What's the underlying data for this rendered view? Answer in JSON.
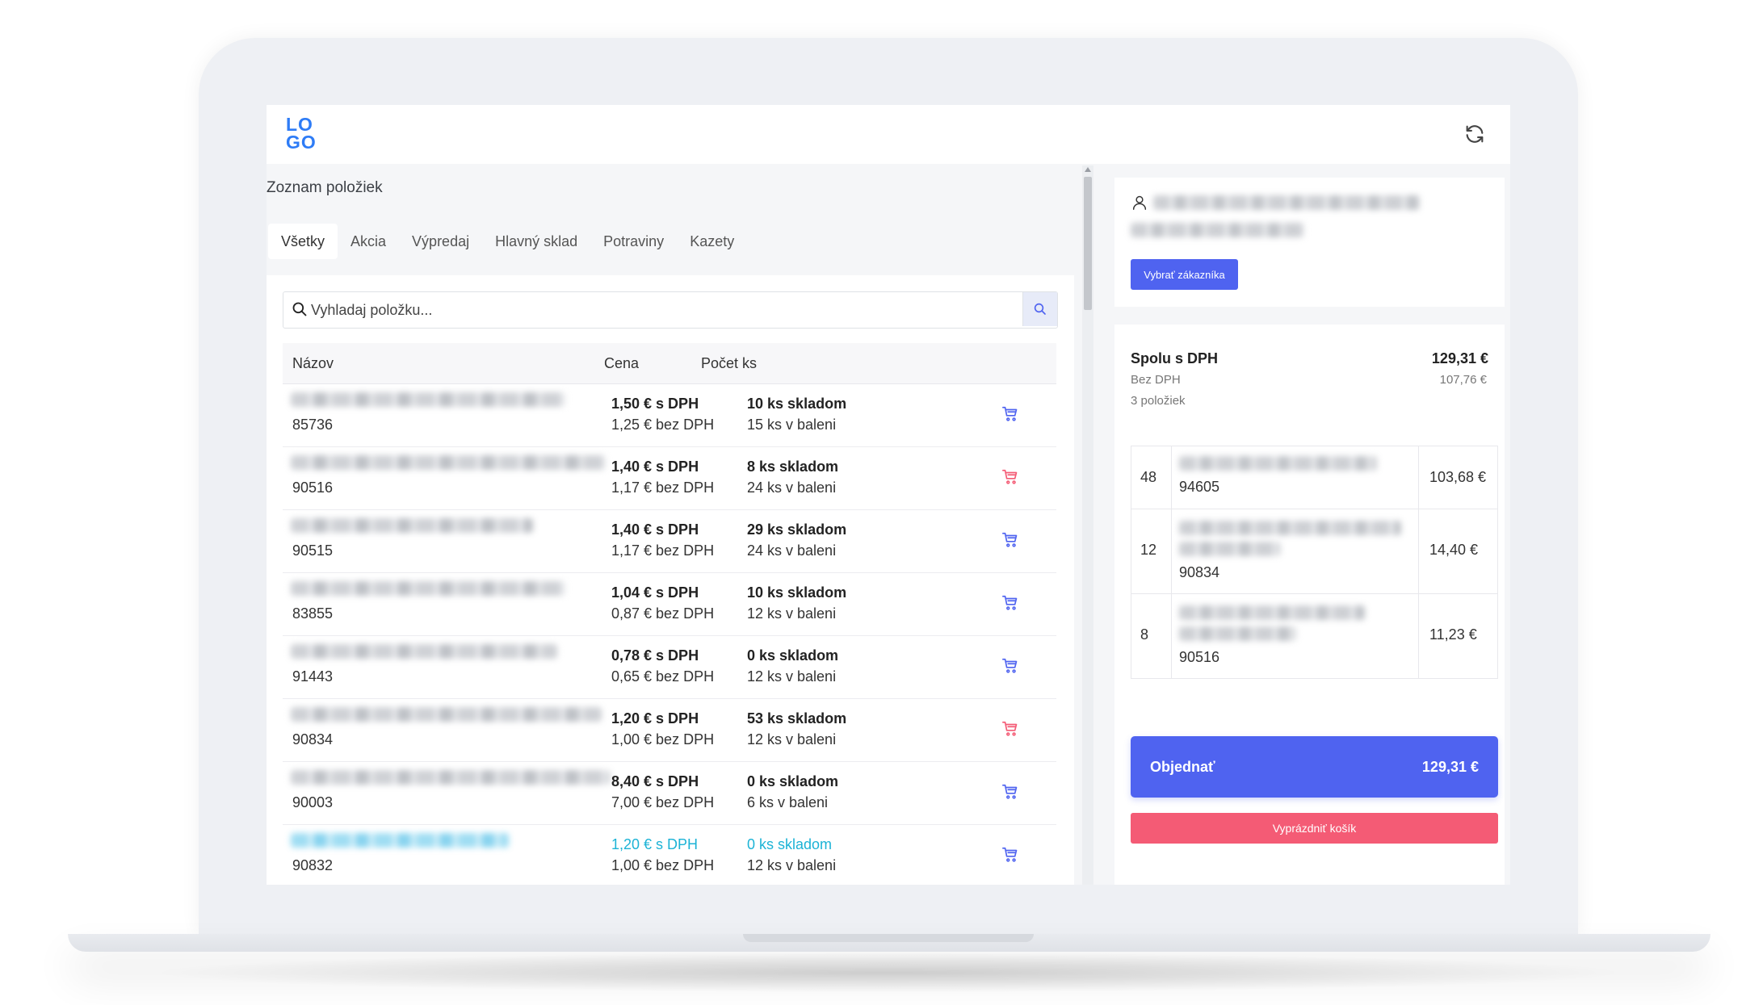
{
  "app": {
    "logo_line1": "LO",
    "logo_line2": "GO"
  },
  "list": {
    "title": "Zoznam položiek",
    "tabs": [
      "Všetky",
      "Akcia",
      "Výpredaj",
      "Hlavný sklad",
      "Potraviny",
      "Kazety"
    ],
    "active_tab": "Všetky",
    "search": {
      "placeholder": "Vyhladaj položku..."
    },
    "columns": {
      "name": "Názov",
      "price": "Cena",
      "count": "Počet ks"
    },
    "rows": [
      {
        "code": "85736",
        "price_vat": "1,50 € s DPH",
        "price_novat": "1,25 € bez DPH",
        "stock": "10 ks skladom",
        "pack": "15 ks v baleni",
        "cart_color": "#4f63f0"
      },
      {
        "code": "90516",
        "price_vat": "1,40 € s DPH",
        "price_novat": "1,17 € bez DPH",
        "stock": "8 ks skladom",
        "pack": "24 ks v baleni",
        "cart_color": "#f45b75"
      },
      {
        "code": "90515",
        "price_vat": "1,40 € s DPH",
        "price_novat": "1,17 € bez DPH",
        "stock": "29 ks skladom",
        "pack": "24 ks v baleni",
        "cart_color": "#4f63f0"
      },
      {
        "code": "83855",
        "price_vat": "1,04 € s DPH",
        "price_novat": "0,87 € bez DPH",
        "stock": "10 ks skladom",
        "pack": "12 ks v baleni",
        "cart_color": "#4f63f0"
      },
      {
        "code": "91443",
        "price_vat": "0,78 € s DPH",
        "price_novat": "0,65 € bez DPH",
        "stock": "0 ks skladom",
        "pack": "12 ks v baleni",
        "cart_color": "#4f63f0"
      },
      {
        "code": "90834",
        "price_vat": "1,20 € s DPH",
        "price_novat": "1,00 € bez DPH",
        "stock": "53 ks skladom",
        "pack": "12 ks v baleni",
        "cart_color": "#f45b75"
      },
      {
        "code": "90003",
        "price_vat": "8,40 € s DPH",
        "price_novat": "7,00 € bez DPH",
        "stock": "0 ks skladom",
        "pack": "6 ks v baleni",
        "cart_color": "#4f63f0"
      },
      {
        "code": "90832",
        "price_vat": "1,20 € s DPH",
        "price_novat": "1,00 € bez DPH",
        "stock": "0 ks skladom",
        "pack": "12 ks v baleni",
        "cart_color": "#4f63f0"
      }
    ]
  },
  "customer": {
    "select_button": "Vybrať zákazníka"
  },
  "summary": {
    "title": "Spolu s DPH",
    "total": "129,31 €",
    "subtitle": "Bez DPH",
    "subtotal": "107,76 €",
    "count": "3 položiek",
    "items": [
      {
        "qty": "48",
        "code": "94605",
        "price": "103,68 €"
      },
      {
        "qty": "12",
        "code": "90834",
        "price": "14,40 €"
      },
      {
        "qty": "8",
        "code": "90516",
        "price": "11,23 €"
      }
    ],
    "order_label": "Objednať",
    "order_total": "129,31 €",
    "empty_label": "Vyprázdniť košík"
  },
  "colors": {
    "accent": "#4f63f0",
    "danger": "#f45b75",
    "highlight": "#1cb3d6",
    "logo": "#2e7cf6"
  }
}
